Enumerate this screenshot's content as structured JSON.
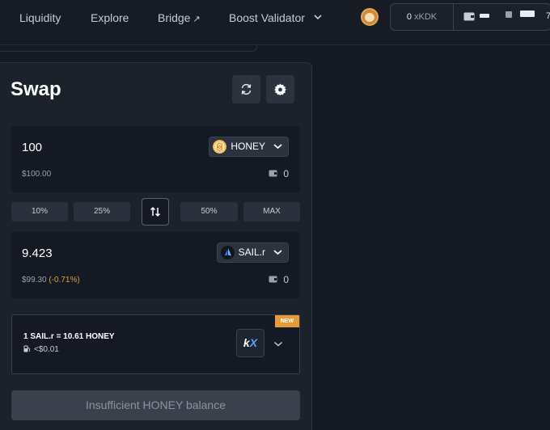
{
  "nav": {
    "liquidity": "Liquidity",
    "explore": "Explore",
    "bridge": "Bridge",
    "bridge_arrow": "↗",
    "boost_validator": "Boost Validator"
  },
  "account": {
    "xkdk_amount": "0",
    "xkdk_unit": "xKDK",
    "address_suffix": "7"
  },
  "swap": {
    "title": "Swap",
    "from": {
      "amount": "100",
      "usd_value": "$100.00",
      "token": "HONEY",
      "balance": "0"
    },
    "to": {
      "amount": "9.423",
      "usd_value": "$99.30",
      "price_impact": "(-0.71%)",
      "token": "SAIL.r",
      "balance": "0"
    },
    "percent_buttons": [
      "10%",
      "25%",
      "50%",
      "MAX"
    ],
    "route": {
      "badge": "NEW",
      "rate": "1 SAIL.r = 10.61 HONEY",
      "gas": "<$0.01",
      "aggregator_logo_k": "k",
      "aggregator_logo_x": "X"
    },
    "submit_label": "Insufficient HONEY balance"
  },
  "colors": {
    "background": "#141922",
    "panel": "#1c222c",
    "badge": "#e79a3a",
    "negative_impact": "#d9a441"
  }
}
